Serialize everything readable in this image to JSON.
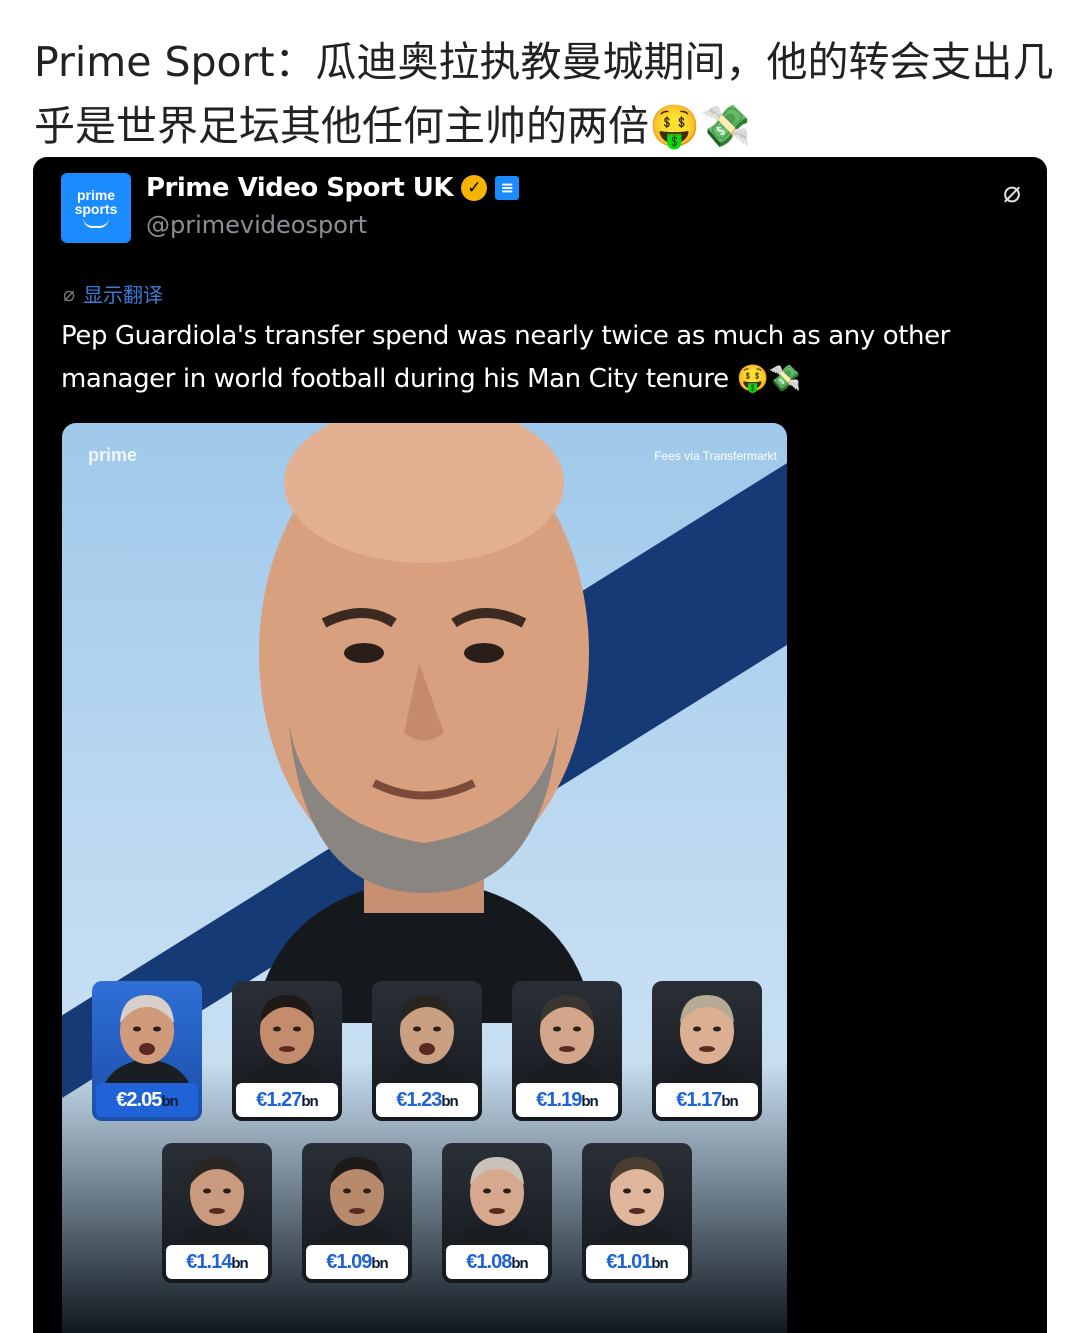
{
  "post": {
    "text": "Prime Sport：瓜迪奥拉执教曼城期间，他的转会支出几乎是世界足坛其他任何主帅的两倍🤑💸"
  },
  "embed": {
    "account_name": "Prime Video Sport UK",
    "handle": "@primevideosport",
    "logo_line1": "prime",
    "logo_line2": "sports",
    "translate_label": "显示翻译",
    "tweet_text": "Pep Guardiola's transfer spend was nearly twice as much as any other manager in world football during his Man City tenure 🤑💸",
    "verified_badge_color": "#f4b400",
    "affiliate_badge_color": "#1a8cff"
  },
  "graphic": {
    "brand_mark": "prime",
    "source": "Fees via Transfermarkt",
    "accent_color": "#1f63d6",
    "currency_unit": "bn",
    "managers": [
      {
        "value": "€2.05"
      },
      {
        "value": "€1.27"
      },
      {
        "value": "€1.23"
      },
      {
        "value": "€1.19"
      },
      {
        "value": "€1.17"
      },
      {
        "value": "€1.14"
      },
      {
        "value": "€1.09"
      },
      {
        "value": "€1.08"
      },
      {
        "value": "€1.01"
      }
    ]
  },
  "icons": {
    "verified": "verified-check-icon",
    "affiliate": "affiliate-badge-icon",
    "grok": "grok-icon",
    "translate": "translate-icon"
  }
}
